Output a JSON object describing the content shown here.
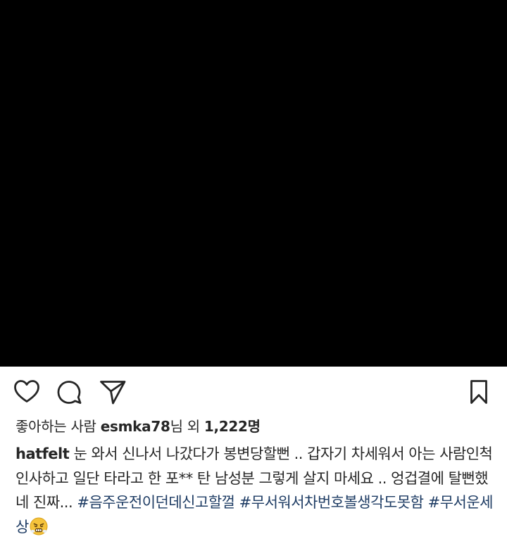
{
  "post": {
    "image": {
      "description": "",
      "background": "#000000"
    },
    "actions": {
      "like_icon": "heart-icon",
      "comment_icon": "comment-icon",
      "share_icon": "paper-plane-icon",
      "save_icon": "bookmark-icon"
    },
    "likes": {
      "prefix": "좋아하는 사람 ",
      "user": "esmka78",
      "middle": "님 외 ",
      "count": "1,222명"
    },
    "caption": {
      "username": "hatfelt",
      "text": " 눈 와서 신나서 나갔다가 봉변당할뻔 .. 갑자기 차세워서 아는 사람인척 인사하고 일단 타라고 한 포** 탄 남성분 그렇게 살지 마세요 .. 엉겁결에 탈뻔했네 진짜... ",
      "hashtags": [
        "#음주운전이던데신고할껄",
        "#무서워서차번호볼생각도못함",
        "#무서운세상"
      ],
      "emoji": "angry-steam-face-emoji"
    },
    "colors": {
      "hashtag": "#1e3c64",
      "text": "#262626",
      "emoji": "#f5c33b"
    }
  }
}
